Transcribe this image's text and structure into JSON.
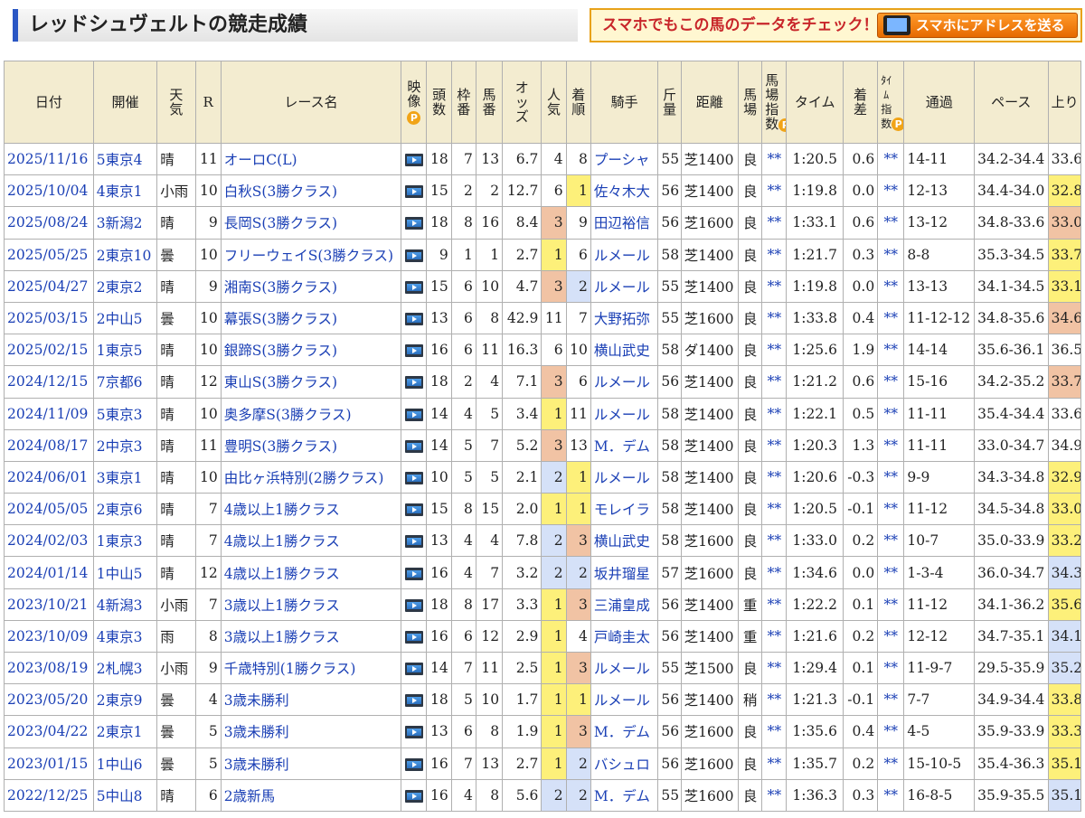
{
  "page_title": "レッドシュヴェルトの競走成績",
  "promo": {
    "text": "スマホでもこの馬のデータをチェック！",
    "button": "スマホにアドレスを送る"
  },
  "headers": {
    "date": "日付",
    "venue": "開催",
    "weather": "天気",
    "race_no": "R",
    "race_name": "レース名",
    "video": "映像",
    "runners": "頭数",
    "frame": "枠番",
    "horse_no": "馬番",
    "odds": "オッズ",
    "popularity": "人気",
    "finish": "着順",
    "jockey": "騎手",
    "weight": "斤量",
    "distance": "距離",
    "track": "馬場",
    "track_index": "馬場指数",
    "time": "タイム",
    "margin": "着差",
    "time_index": "ﾀｲﾑ指数",
    "passing": "通過",
    "pace": "ペース",
    "last3f": "上り",
    "p_mark": "P"
  },
  "highlight_colors": {
    "1": "#fdf07a",
    "2": "#d5e1f8",
    "3": "#f1c3a4"
  },
  "rows": [
    {
      "date": "2025/11/16",
      "venue": "5東京4",
      "weather": "晴",
      "race_no": "11",
      "race_name": "オーロC(L)",
      "runners": "18",
      "frame": "7",
      "horse_no": "13",
      "odds": "6.7",
      "popularity": "4",
      "finish": "8",
      "jockey": "プーシャ",
      "weight": "55",
      "distance": "芝1400",
      "track": "良",
      "track_index": "**",
      "time": "1:20.5",
      "margin": "0.6",
      "time_index": "**",
      "passing": "14-11",
      "pace": "34.2-34.4",
      "last3f": "33.6",
      "pop_hl": "",
      "fin_hl": "",
      "last_hl": ""
    },
    {
      "date": "2025/10/04",
      "venue": "4東京1",
      "weather": "小雨",
      "race_no": "10",
      "race_name": "白秋S(3勝クラス)",
      "runners": "15",
      "frame": "2",
      "horse_no": "2",
      "odds": "12.7",
      "popularity": "6",
      "finish": "1",
      "jockey": "佐々木大",
      "weight": "56",
      "distance": "芝1400",
      "track": "良",
      "track_index": "**",
      "time": "1:19.8",
      "margin": "0.0",
      "time_index": "**",
      "passing": "12-13",
      "pace": "34.4-34.0",
      "last3f": "32.8",
      "pop_hl": "",
      "fin_hl": "hl1",
      "last_hl": "hl1"
    },
    {
      "date": "2025/08/24",
      "venue": "3新潟2",
      "weather": "晴",
      "race_no": "9",
      "race_name": "長岡S(3勝クラス)",
      "runners": "18",
      "frame": "8",
      "horse_no": "16",
      "odds": "8.4",
      "popularity": "3",
      "finish": "9",
      "jockey": "田辺裕信",
      "weight": "56",
      "distance": "芝1600",
      "track": "良",
      "track_index": "**",
      "time": "1:33.1",
      "margin": "0.6",
      "time_index": "**",
      "passing": "13-12",
      "pace": "34.8-33.6",
      "last3f": "33.0",
      "pop_hl": "hl3",
      "fin_hl": "",
      "last_hl": "hl3"
    },
    {
      "date": "2025/05/25",
      "venue": "2東京10",
      "weather": "曇",
      "race_no": "10",
      "race_name": "フリーウェイS(3勝クラス)",
      "runners": "9",
      "frame": "1",
      "horse_no": "1",
      "odds": "2.7",
      "popularity": "1",
      "finish": "6",
      "jockey": "ルメール",
      "weight": "58",
      "distance": "芝1400",
      "track": "良",
      "track_index": "**",
      "time": "1:21.7",
      "margin": "0.3",
      "time_index": "**",
      "passing": "8-8",
      "pace": "35.3-34.5",
      "last3f": "33.7",
      "pop_hl": "hl1",
      "fin_hl": "",
      "last_hl": "hl1"
    },
    {
      "date": "2025/04/27",
      "venue": "2東京2",
      "weather": "晴",
      "race_no": "9",
      "race_name": "湘南S(3勝クラス)",
      "runners": "15",
      "frame": "6",
      "horse_no": "10",
      "odds": "4.7",
      "popularity": "3",
      "finish": "2",
      "jockey": "ルメール",
      "weight": "55",
      "distance": "芝1400",
      "track": "良",
      "track_index": "**",
      "time": "1:19.8",
      "margin": "0.0",
      "time_index": "**",
      "passing": "13-13",
      "pace": "34.1-34.5",
      "last3f": "33.1",
      "pop_hl": "hl3",
      "fin_hl": "hl2",
      "last_hl": "hl1"
    },
    {
      "date": "2025/03/15",
      "venue": "2中山5",
      "weather": "曇",
      "race_no": "10",
      "race_name": "幕張S(3勝クラス)",
      "runners": "13",
      "frame": "6",
      "horse_no": "8",
      "odds": "42.9",
      "popularity": "11",
      "finish": "7",
      "jockey": "大野拓弥",
      "weight": "55",
      "distance": "芝1600",
      "track": "良",
      "track_index": "**",
      "time": "1:33.8",
      "margin": "0.4",
      "time_index": "**",
      "passing": "11-12-12",
      "pace": "34.8-35.6",
      "last3f": "34.6",
      "pop_hl": "",
      "fin_hl": "",
      "last_hl": "hl3"
    },
    {
      "date": "2025/02/15",
      "venue": "1東京5",
      "weather": "晴",
      "race_no": "10",
      "race_name": "銀蹄S(3勝クラス)",
      "runners": "16",
      "frame": "6",
      "horse_no": "11",
      "odds": "16.3",
      "popularity": "6",
      "finish": "10",
      "jockey": "横山武史",
      "weight": "58",
      "distance": "ダ1400",
      "track": "良",
      "track_index": "**",
      "time": "1:25.6",
      "margin": "1.9",
      "time_index": "**",
      "passing": "14-14",
      "pace": "35.6-36.1",
      "last3f": "36.5",
      "pop_hl": "",
      "fin_hl": "",
      "last_hl": ""
    },
    {
      "date": "2024/12/15",
      "venue": "7京都6",
      "weather": "晴",
      "race_no": "12",
      "race_name": "東山S(3勝クラス)",
      "runners": "18",
      "frame": "2",
      "horse_no": "4",
      "odds": "7.1",
      "popularity": "3",
      "finish": "6",
      "jockey": "ルメール",
      "weight": "56",
      "distance": "芝1400",
      "track": "良",
      "track_index": "**",
      "time": "1:21.2",
      "margin": "0.6",
      "time_index": "**",
      "passing": "15-16",
      "pace": "34.2-35.2",
      "last3f": "33.7",
      "pop_hl": "hl3",
      "fin_hl": "",
      "last_hl": "hl3"
    },
    {
      "date": "2024/11/09",
      "venue": "5東京3",
      "weather": "晴",
      "race_no": "10",
      "race_name": "奥多摩S(3勝クラス)",
      "runners": "14",
      "frame": "4",
      "horse_no": "5",
      "odds": "3.4",
      "popularity": "1",
      "finish": "11",
      "jockey": "ルメール",
      "weight": "58",
      "distance": "芝1400",
      "track": "良",
      "track_index": "**",
      "time": "1:22.1",
      "margin": "0.5",
      "time_index": "**",
      "passing": "11-11",
      "pace": "35.4-34.4",
      "last3f": "33.6",
      "pop_hl": "hl1",
      "fin_hl": "",
      "last_hl": ""
    },
    {
      "date": "2024/08/17",
      "venue": "2中京3",
      "weather": "晴",
      "race_no": "11",
      "race_name": "豊明S(3勝クラス)",
      "runners": "14",
      "frame": "5",
      "horse_no": "7",
      "odds": "5.2",
      "popularity": "3",
      "finish": "13",
      "jockey": "M．デム",
      "weight": "58",
      "distance": "芝1400",
      "track": "良",
      "track_index": "**",
      "time": "1:20.3",
      "margin": "1.3",
      "time_index": "**",
      "passing": "11-11",
      "pace": "33.0-34.7",
      "last3f": "34.9",
      "pop_hl": "hl3",
      "fin_hl": "",
      "last_hl": ""
    },
    {
      "date": "2024/06/01",
      "venue": "3東京1",
      "weather": "晴",
      "race_no": "10",
      "race_name": "由比ヶ浜特別(2勝クラス)",
      "runners": "10",
      "frame": "5",
      "horse_no": "5",
      "odds": "2.1",
      "popularity": "2",
      "finish": "1",
      "jockey": "ルメール",
      "weight": "58",
      "distance": "芝1400",
      "track": "良",
      "track_index": "**",
      "time": "1:20.6",
      "margin": "-0.3",
      "time_index": "**",
      "passing": "9-9",
      "pace": "34.3-34.8",
      "last3f": "32.9",
      "pop_hl": "hl2",
      "fin_hl": "hl1",
      "last_hl": "hl1"
    },
    {
      "date": "2024/05/05",
      "venue": "2東京6",
      "weather": "晴",
      "race_no": "7",
      "race_name": "4歳以上1勝クラス",
      "runners": "15",
      "frame": "8",
      "horse_no": "15",
      "odds": "2.0",
      "popularity": "1",
      "finish": "1",
      "jockey": "モレイラ",
      "weight": "58",
      "distance": "芝1400",
      "track": "良",
      "track_index": "**",
      "time": "1:20.5",
      "margin": "-0.1",
      "time_index": "**",
      "passing": "11-12",
      "pace": "34.5-34.8",
      "last3f": "33.0",
      "pop_hl": "hl1",
      "fin_hl": "hl1",
      "last_hl": "hl1"
    },
    {
      "date": "2024/02/03",
      "venue": "1東京3",
      "weather": "晴",
      "race_no": "7",
      "race_name": "4歳以上1勝クラス",
      "runners": "13",
      "frame": "4",
      "horse_no": "4",
      "odds": "7.8",
      "popularity": "2",
      "finish": "3",
      "jockey": "横山武史",
      "weight": "58",
      "distance": "芝1600",
      "track": "良",
      "track_index": "**",
      "time": "1:33.0",
      "margin": "0.2",
      "time_index": "**",
      "passing": "10-7",
      "pace": "35.0-33.9",
      "last3f": "33.2",
      "pop_hl": "hl2",
      "fin_hl": "hl3",
      "last_hl": "hl1"
    },
    {
      "date": "2024/01/14",
      "venue": "1中山5",
      "weather": "晴",
      "race_no": "12",
      "race_name": "4歳以上1勝クラス",
      "runners": "16",
      "frame": "4",
      "horse_no": "7",
      "odds": "3.2",
      "popularity": "2",
      "finish": "2",
      "jockey": "坂井瑠星",
      "weight": "57",
      "distance": "芝1600",
      "track": "良",
      "track_index": "**",
      "time": "1:34.6",
      "margin": "0.0",
      "time_index": "**",
      "passing": "1-3-4",
      "pace": "36.0-34.7",
      "last3f": "34.3",
      "pop_hl": "hl2",
      "fin_hl": "hl2",
      "last_hl": "hl2"
    },
    {
      "date": "2023/10/21",
      "venue": "4新潟3",
      "weather": "小雨",
      "race_no": "7",
      "race_name": "3歳以上1勝クラス",
      "runners": "18",
      "frame": "8",
      "horse_no": "17",
      "odds": "3.3",
      "popularity": "1",
      "finish": "3",
      "jockey": "三浦皇成",
      "weight": "56",
      "distance": "芝1400",
      "track": "重",
      "track_index": "**",
      "time": "1:22.2",
      "margin": "0.1",
      "time_index": "**",
      "passing": "11-12",
      "pace": "34.1-36.2",
      "last3f": "35.6",
      "pop_hl": "hl1",
      "fin_hl": "hl3",
      "last_hl": "hl1"
    },
    {
      "date": "2023/10/09",
      "venue": "4東京3",
      "weather": "雨",
      "race_no": "8",
      "race_name": "3歳以上1勝クラス",
      "runners": "16",
      "frame": "6",
      "horse_no": "12",
      "odds": "2.9",
      "popularity": "1",
      "finish": "4",
      "jockey": "戸崎圭太",
      "weight": "56",
      "distance": "芝1400",
      "track": "重",
      "track_index": "**",
      "time": "1:21.6",
      "margin": "0.2",
      "time_index": "**",
      "passing": "12-12",
      "pace": "34.7-35.1",
      "last3f": "34.1",
      "pop_hl": "hl1",
      "fin_hl": "",
      "last_hl": "hl2"
    },
    {
      "date": "2023/08/19",
      "venue": "2札幌3",
      "weather": "小雨",
      "race_no": "9",
      "race_name": "千歳特別(1勝クラス)",
      "runners": "14",
      "frame": "7",
      "horse_no": "11",
      "odds": "2.5",
      "popularity": "1",
      "finish": "3",
      "jockey": "ルメール",
      "weight": "55",
      "distance": "芝1500",
      "track": "良",
      "track_index": "**",
      "time": "1:29.4",
      "margin": "0.1",
      "time_index": "**",
      "passing": "11-9-7",
      "pace": "29.5-35.9",
      "last3f": "35.2",
      "pop_hl": "hl1",
      "fin_hl": "hl3",
      "last_hl": "hl2"
    },
    {
      "date": "2023/05/20",
      "venue": "2東京9",
      "weather": "曇",
      "race_no": "4",
      "race_name": "3歳未勝利",
      "runners": "18",
      "frame": "5",
      "horse_no": "10",
      "odds": "1.7",
      "popularity": "1",
      "finish": "1",
      "jockey": "ルメール",
      "weight": "56",
      "distance": "芝1400",
      "track": "稍",
      "track_index": "**",
      "time": "1:21.3",
      "margin": "-0.1",
      "time_index": "**",
      "passing": "7-7",
      "pace": "34.9-34.4",
      "last3f": "33.8",
      "pop_hl": "hl1",
      "fin_hl": "hl1",
      "last_hl": "hl1"
    },
    {
      "date": "2023/04/22",
      "venue": "2東京1",
      "weather": "曇",
      "race_no": "5",
      "race_name": "3歳未勝利",
      "runners": "13",
      "frame": "6",
      "horse_no": "8",
      "odds": "1.9",
      "popularity": "1",
      "finish": "3",
      "jockey": "M．デム",
      "weight": "56",
      "distance": "芝1600",
      "track": "良",
      "track_index": "**",
      "time": "1:35.6",
      "margin": "0.4",
      "time_index": "**",
      "passing": "4-5",
      "pace": "35.9-33.9",
      "last3f": "33.3",
      "pop_hl": "hl1",
      "fin_hl": "hl3",
      "last_hl": "hl1"
    },
    {
      "date": "2023/01/15",
      "venue": "1中山6",
      "weather": "曇",
      "race_no": "5",
      "race_name": "3歳未勝利",
      "runners": "16",
      "frame": "7",
      "horse_no": "13",
      "odds": "2.7",
      "popularity": "1",
      "finish": "2",
      "jockey": "バシュロ",
      "weight": "56",
      "distance": "芝1600",
      "track": "良",
      "track_index": "**",
      "time": "1:35.7",
      "margin": "0.2",
      "time_index": "**",
      "passing": "15-10-5",
      "pace": "35.4-36.3",
      "last3f": "35.1",
      "pop_hl": "hl1",
      "fin_hl": "hl2",
      "last_hl": "hl1"
    },
    {
      "date": "2022/12/25",
      "venue": "5中山8",
      "weather": "晴",
      "race_no": "6",
      "race_name": "2歳新馬",
      "runners": "16",
      "frame": "4",
      "horse_no": "8",
      "odds": "5.6",
      "popularity": "2",
      "finish": "2",
      "jockey": "M．デム",
      "weight": "55",
      "distance": "芝1600",
      "track": "良",
      "track_index": "**",
      "time": "1:36.3",
      "margin": "0.3",
      "time_index": "**",
      "passing": "16-8-5",
      "pace": "35.9-35.5",
      "last3f": "35.1",
      "pop_hl": "hl2",
      "fin_hl": "hl2",
      "last_hl": "hl2"
    }
  ]
}
